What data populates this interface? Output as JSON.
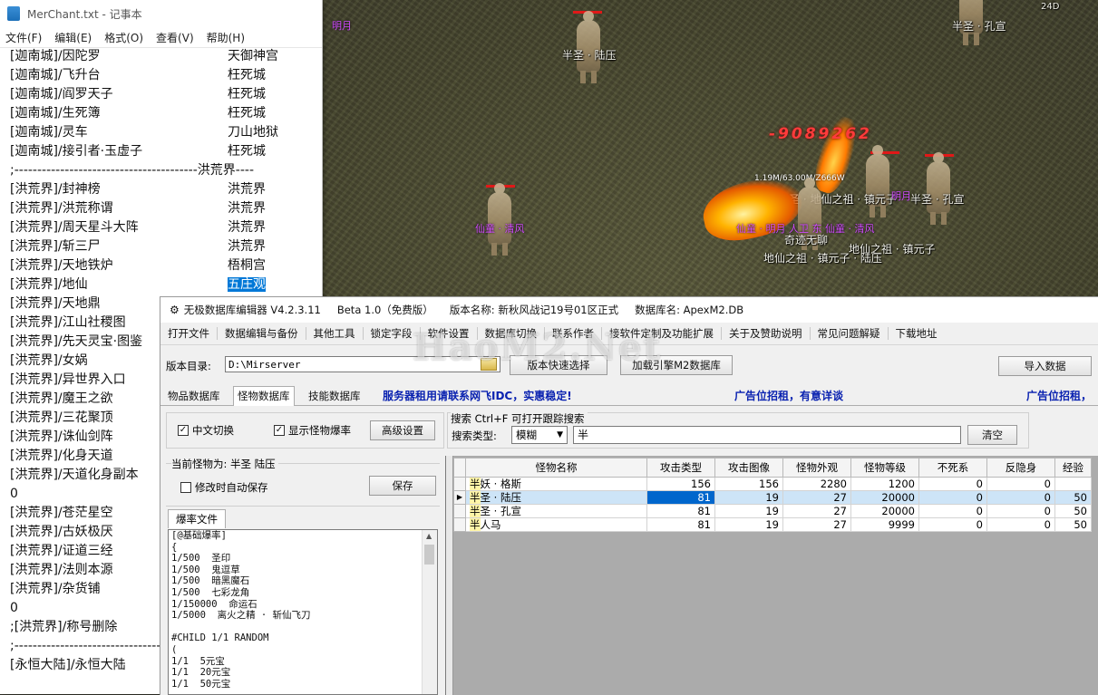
{
  "notepad": {
    "title": "MerChant.txt - 记事本",
    "menu": [
      "文件(F)",
      "编辑(E)",
      "格式(O)",
      "查看(V)",
      "帮助(H)"
    ],
    "lines": [
      {
        "a": "[迦南城]/因陀罗",
        "b": "天御神宫"
      },
      {
        "a": "[迦南城]/飞升台",
        "b": "枉死城"
      },
      {
        "a": "[迦南城]/阎罗天子",
        "b": "枉死城"
      },
      {
        "a": "[迦南城]/生死簿",
        "b": "枉死城"
      },
      {
        "a": "[迦南城]/灵车",
        "b": "刀山地狱"
      },
      {
        "a": "[迦南城]/接引者·玉虚子",
        "b": "枉死城"
      },
      {
        "a": ";----------------------------------------洪荒界----",
        "b": ""
      },
      {
        "a": "[洪荒界]/封神榜",
        "b": "洪荒界"
      },
      {
        "a": "[洪荒界]/洪荒称谓",
        "b": "洪荒界"
      },
      {
        "a": "[洪荒界]/周天星斗大阵",
        "b": "洪荒界"
      },
      {
        "a": "[洪荒界]/斩三尸",
        "b": "洪荒界"
      },
      {
        "a": "[洪荒界]/天地铁炉",
        "b": "梧桐宫"
      },
      {
        "a": "[洪荒界]/地仙",
        "b": "五庄观",
        "selected": true
      },
      {
        "a": "[洪荒界]/天地鼎",
        "b": ""
      },
      {
        "a": "[洪荒界]/江山社稷图",
        "b": ""
      },
      {
        "a": "[洪荒界]/先天灵宝·图鉴",
        "b": ""
      },
      {
        "a": "[洪荒界]/女娲",
        "b": ""
      },
      {
        "a": "[洪荒界]/异世界入口",
        "b": ""
      },
      {
        "a": "[洪荒界]/魔王之欲",
        "b": ""
      },
      {
        "a": "[洪荒界]/三花聚顶",
        "b": ""
      },
      {
        "a": "[洪荒界]/诛仙剑阵",
        "b": ""
      },
      {
        "a": "[洪荒界]/化身天道",
        "b": ""
      },
      {
        "a": "[洪荒界]/天道化身副本",
        "b": ""
      },
      {
        "a": "0",
        "b": ""
      },
      {
        "a": "[洪荒界]/苍茫星空",
        "b": ""
      },
      {
        "a": "[洪荒界]/古妖极厌",
        "b": ""
      },
      {
        "a": "[洪荒界]/证道三经",
        "b": ""
      },
      {
        "a": "[洪荒界]/法则本源",
        "b": ""
      },
      {
        "a": "[洪荒界]/杂货铺",
        "b": ""
      },
      {
        "a": "0",
        "b": ""
      },
      {
        "a": ";[洪荒界]/称号删除",
        "b": ""
      },
      {
        "a": ";----------------------------------------",
        "b": ""
      },
      {
        "a": "[永恒大陆]/永恒大陆",
        "b": ""
      }
    ]
  },
  "game": {
    "labels": {
      "top_a": "半圣 · 陆压",
      "top_b": "半圣 · 孔宣",
      "purple_top": "明月",
      "hpinfo": "1.19M/63.00M/Z666W",
      "mid_a": "半圣 · 地仙之祖 · 镇元子",
      "mid_b": "半圣 · 孔宣",
      "mid_purple": "明月",
      "left_purple": "仙童 · 清风",
      "center_purple": "仙童 · 明月 人卫 东 仙童 · 清风",
      "player": "奇迹无聊",
      "bottom_a": "地仙之祖 · 镇元子",
      "bottom_b": "地仙之祖 · 镇元子 · 陆压",
      "corner": "24D"
    },
    "damage": "-9089262",
    "watermark": "HaoM2.Net"
  },
  "editor": {
    "title": {
      "icon": "⚙",
      "name": "无极数据库编辑器 V4.2.3.11",
      "beta": "Beta 1.0（免费版）",
      "version": "版本名称: 新秋风战记19号01区正式",
      "db": "数据库名: ApexM2.DB"
    },
    "menu": [
      "打开文件",
      "数据编辑与备份",
      "其他工具",
      "锁定字段",
      "软件设置",
      "数据库切换",
      "联系作者",
      "接软件定制及功能扩展",
      "关于及赞助说明",
      "常见问题解疑",
      "下载地址"
    ],
    "dir_label": "版本目录:",
    "dir_value": "D:\\Mirserver",
    "btn_version": "版本快速选择",
    "btn_load": "加载引擎M2数据库",
    "btn_import": "导入数据",
    "tabs": [
      "物品数据库",
      "怪物数据库",
      "技能数据库"
    ],
    "ads": [
      "服务器租用请联系网飞IDC，实惠稳定!",
      "广告位招租，有意详谈",
      "广告位招租，"
    ],
    "chk_chinese": "中文切换",
    "chk_drop": "显示怪物爆率",
    "btn_adv": "高级设置",
    "search_caption": "搜索   Ctrl+F 可打开跟踪搜索",
    "search_type_label": "搜索类型:",
    "search_type": "模糊",
    "search_value": "半",
    "btn_clear": "清空",
    "current_monster": "当前怪物为: 半圣 陆压",
    "chk_autosave": "修改时自动保存",
    "btn_save": "保存",
    "drop_tab": "爆率文件",
    "drop_lines": [
      "[@基础爆率]",
      "{",
      "1/500  圣印",
      "1/500  鬼逗草",
      "1/500  暗黑魔石",
      "1/500  七彩龙角",
      "1/150000  命运石",
      "1/5000  离火之精 · 斩仙飞刀",
      "",
      "#CHILD 1/1 RANDOM",
      "(",
      "1/1  5元宝",
      "1/1  20元宝",
      "1/1  50元宝"
    ],
    "grid": {
      "headers": [
        "怪物名称",
        "攻击类型",
        "攻击图像",
        "怪物外观",
        "怪物等级",
        "不死系",
        "反隐身",
        "经验"
      ],
      "rows": [
        {
          "prefix": "半",
          "name": "妖 · 格斯",
          "c1": "156",
          "c2": "156",
          "c3": "2280",
          "c4": "1200",
          "c5": "0",
          "c6": "0",
          "c7": ""
        },
        {
          "prefix": "半",
          "name": "圣 · 陆压",
          "c1": "81",
          "c2": "19",
          "c3": "27",
          "c4": "20000",
          "c5": "0",
          "c6": "0",
          "c7": "50",
          "selected": true
        },
        {
          "prefix": "半",
          "name": "圣 · 孔宣",
          "c1": "81",
          "c2": "19",
          "c3": "27",
          "c4": "20000",
          "c5": "0",
          "c6": "0",
          "c7": "50"
        },
        {
          "prefix": "半",
          "name": "人马",
          "c1": "81",
          "c2": "19",
          "c3": "27",
          "c4": "9999",
          "c5": "0",
          "c6": "0",
          "c7": "50"
        }
      ]
    }
  }
}
